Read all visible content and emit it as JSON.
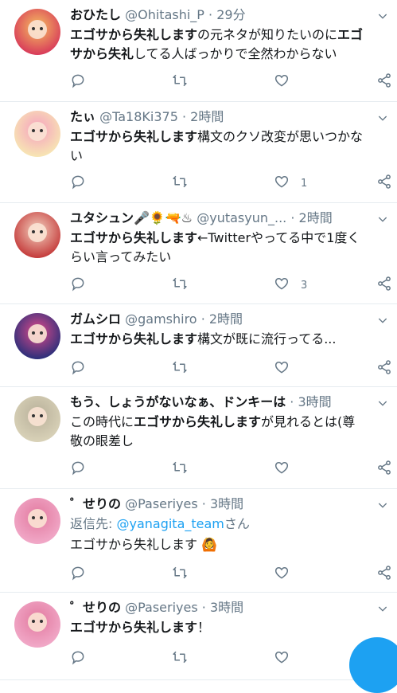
{
  "tweets": [
    {
      "name": "おひたし",
      "handle": "@Ohitashi_P",
      "time": "29分",
      "text_parts": [
        {
          "t": "エゴサから失礼します",
          "b": true
        },
        {
          "t": "の元ネタが知りたいのに",
          "b": false
        },
        {
          "t": "エゴサから失礼",
          "b": true
        },
        {
          "t": "してる人ばっかりで全然わからない",
          "b": false
        }
      ],
      "likes": ""
    },
    {
      "name": "たぃ",
      "handle": "@Ta18Ki375",
      "time": "2時間",
      "text_parts": [
        {
          "t": "エゴサから失礼します",
          "b": true
        },
        {
          "t": "構文のクソ改変が思いつかない",
          "b": false
        }
      ],
      "likes": "1"
    },
    {
      "name": "ユタシュン🎤🌻🔫♨",
      "handle": "@yutasyun_...",
      "time": "2時間",
      "text_parts": [
        {
          "t": "エゴサから失礼します",
          "b": true
        },
        {
          "t": "←Twitterやってる中で1度くらい言ってみたい",
          "b": false
        }
      ],
      "likes": "3"
    },
    {
      "name": "ガムシロ",
      "handle": "@gamshiro",
      "time": "2時間",
      "text_parts": [
        {
          "t": "エゴサから失礼します",
          "b": true
        },
        {
          "t": "構文が既に流行ってる...",
          "b": false
        }
      ],
      "likes": ""
    },
    {
      "name": "もう、しょうがないなぁ、ドンキーは",
      "handle": "",
      "time": "3時間",
      "text_parts": [
        {
          "t": "この時代に",
          "b": false
        },
        {
          "t": "エゴサから失礼します",
          "b": true
        },
        {
          "t": "が見れるとは(尊敬の眼差し",
          "b": false
        }
      ],
      "likes": ""
    },
    {
      "name": "゜せりの",
      "handle": "@Paseriyes",
      "time": "3時間",
      "reply_prefix": "返信先: ",
      "reply_user": "@yanagita_team",
      "reply_suffix": "さん",
      "text_parts": [
        {
          "t": "エゴサから失礼します 🙆",
          "b": false
        }
      ],
      "likes": ""
    },
    {
      "name": "゜せりの",
      "handle": "@Paseriyes",
      "time": "3時間",
      "text_parts": [
        {
          "t": "エゴサから失礼します",
          "b": true
        },
        {
          "t": "！",
          "b": false
        }
      ],
      "likes": ""
    }
  ],
  "colors": {
    "icon": "#657786",
    "accent": "#1da1f2",
    "text": "#14171a"
  },
  "icons": [
    "reply-icon",
    "retweet-icon",
    "like-icon",
    "share-icon",
    "caret-down-icon"
  ]
}
